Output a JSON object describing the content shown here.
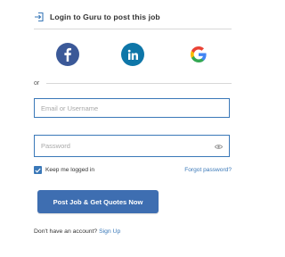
{
  "header": {
    "title": "Login to Guru to post this job",
    "icon": "login-arrow-icon"
  },
  "social": [
    {
      "name": "facebook-icon",
      "color": "#3b5998"
    },
    {
      "name": "linkedin-icon",
      "color": "#0e76a8"
    },
    {
      "name": "google-icon",
      "color": "#4285f4"
    }
  ],
  "separator": {
    "text": "or"
  },
  "form": {
    "email_placeholder": "Email or Username",
    "email_value": "",
    "password_placeholder": "Password",
    "password_value": "",
    "remember_label": "Keep me logged in",
    "remember_checked": true,
    "forgot_label": "Forgot password?",
    "submit_label": "Post Job & Get Quotes Now"
  },
  "footer": {
    "prompt": "Don't have an account?",
    "signup_label": "Sign Up"
  },
  "colors": {
    "accent": "#3a78b8",
    "button": "#3e6eb1",
    "divider": "#d8d8d8"
  }
}
